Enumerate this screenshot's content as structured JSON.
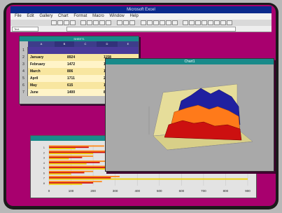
{
  "app": {
    "title": "Microsoft Excel"
  },
  "menu": [
    "File",
    "Edit",
    "Gallery",
    "Chart",
    "Format",
    "Macro",
    "Window",
    "Help"
  ],
  "formula": {
    "name_box": "Text"
  },
  "sheet": {
    "title": "SHEET1",
    "columns": [
      "A",
      "B",
      "C",
      "D",
      "E"
    ],
    "rows": [
      {
        "num": "1",
        "label": "",
        "v1": "",
        "v2": ""
      },
      {
        "num": "2",
        "label": "January",
        "v1": "8924",
        "v2": "1158"
      },
      {
        "num": "3",
        "label": "February",
        "v1": "1472",
        "v2": "1460"
      },
      {
        "num": "4",
        "label": "March",
        "v1": "806",
        "v2": "1700"
      },
      {
        "num": "5",
        "label": "April",
        "v1": "1711",
        "v2": "2540"
      },
      {
        "num": "6",
        "label": "May",
        "v1": "615",
        "v2": "1504"
      },
      {
        "num": "7",
        "label": "June",
        "v1": "1400",
        "v2": "880"
      }
    ]
  },
  "chart3d": {
    "title": "Chart1",
    "heading": "",
    "colors": {
      "blue": "#2020a0",
      "orange": "#ff7a1a",
      "red": "#cc1010",
      "walls": "#e8e0a0",
      "back": "#a8a8a8"
    }
  },
  "chart_data": [
    {
      "type": "bar",
      "title": "",
      "categories": [
        "1",
        "2",
        "3",
        "4",
        "5",
        "6",
        "7",
        "8"
      ],
      "series": [
        {
          "values": [
            250,
            300,
            200,
            280,
            330,
            200,
            320,
            240
          ]
        },
        {
          "values": [
            180,
            260,
            150,
            230,
            300,
            160,
            280,
            200
          ]
        },
        {
          "values": [
            120,
            200,
            90,
            170,
            700,
            100,
            900,
            150
          ]
        }
      ],
      "x_ticks": [
        "0",
        "100",
        "200",
        "300",
        "400",
        "500",
        "600",
        "700",
        "800",
        "900"
      ],
      "xlim": [
        0,
        900
      ],
      "colors": [
        "#ff8a1a",
        "#d01010",
        "#f0d000"
      ]
    }
  ]
}
